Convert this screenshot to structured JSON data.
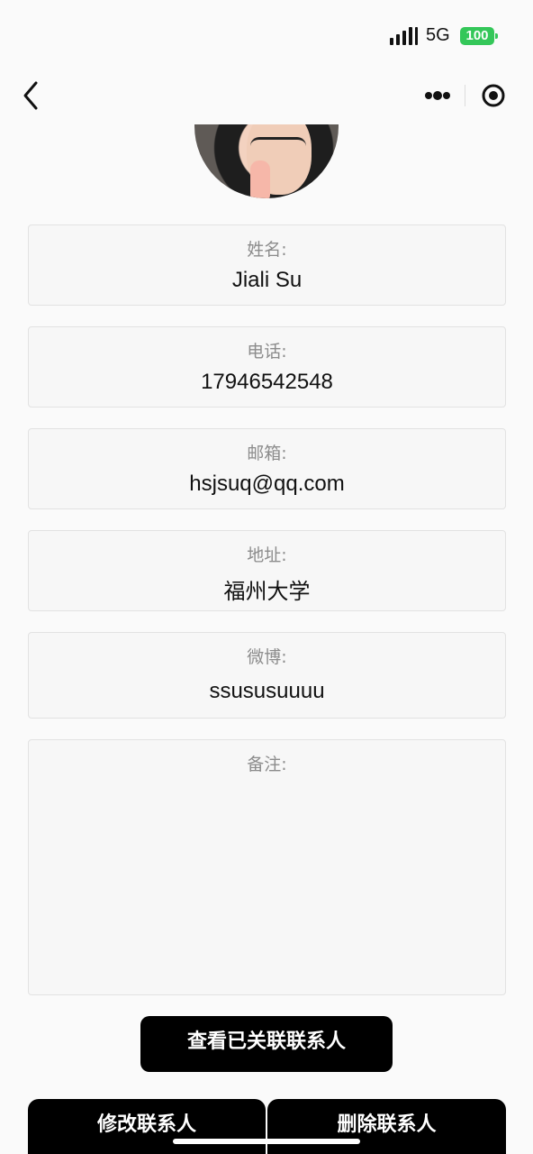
{
  "status_bar": {
    "network": "5G",
    "battery": "100",
    "battery_color": "#34c759"
  },
  "nav": {
    "back_icon": "chevron-left-icon",
    "more_icon": "more-dots-icon",
    "close_icon": "record-circle-icon"
  },
  "avatar": {
    "icon": "profile-photo"
  },
  "fields": {
    "name": {
      "label": "姓名:",
      "value": "Jiali Su"
    },
    "phone": {
      "label": "电话:",
      "value": "17946542548"
    },
    "email": {
      "label": "邮箱:",
      "value": "hsjsuq@qq.com"
    },
    "address": {
      "label": "地址:",
      "value": "福州大学"
    },
    "weibo": {
      "label": "微博:",
      "value": "ssususuuuu"
    },
    "note": {
      "label": "备注:",
      "value": ""
    }
  },
  "buttons": {
    "view_linked": "查看已关联联系人",
    "edit": "修改联系人",
    "delete": "删除联系人"
  },
  "colors": {
    "button_bg": "#000000",
    "label_gray": "#8c8c8c",
    "card_bg": "#f7f7f7"
  }
}
